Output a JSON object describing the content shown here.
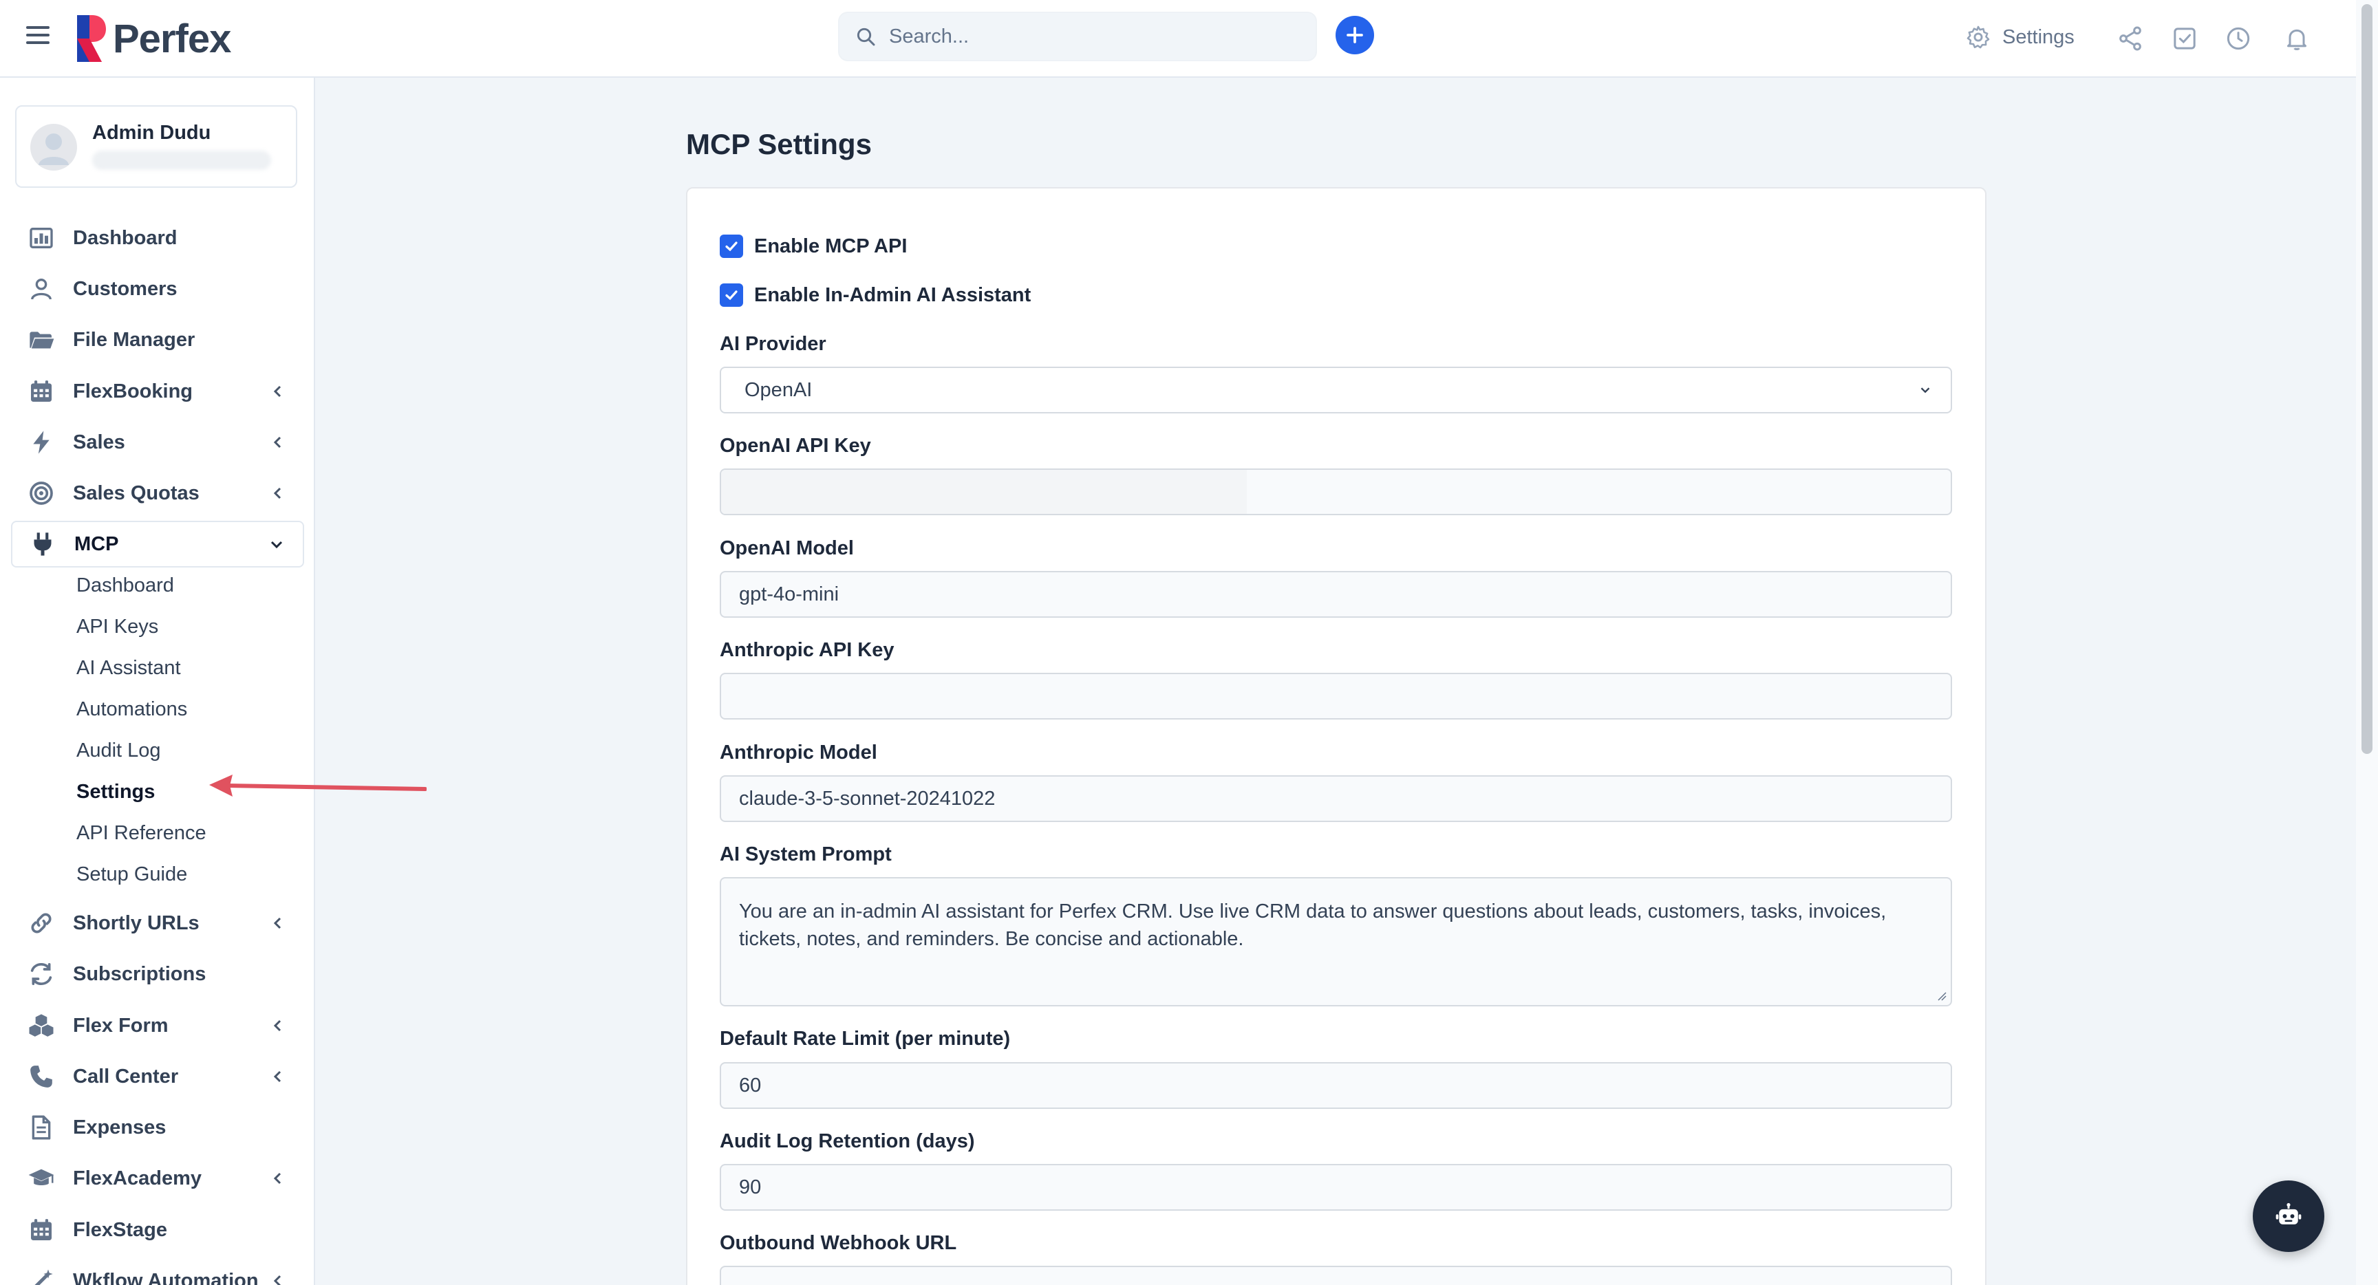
{
  "header": {
    "logo_text": "Perfex",
    "search_placeholder": "Search...",
    "settings_label": "Settings"
  },
  "user": {
    "name": "Admin Dudu"
  },
  "sidebar": {
    "items": [
      {
        "label": "Dashboard",
        "icon": "dashboard-icon"
      },
      {
        "label": "Customers",
        "icon": "user-icon"
      },
      {
        "label": "File Manager",
        "icon": "folder-icon"
      },
      {
        "label": "FlexBooking",
        "icon": "calendar-icon",
        "has_children": true
      },
      {
        "label": "Sales",
        "icon": "bolt-icon",
        "has_children": true
      },
      {
        "label": "Sales Quotas",
        "icon": "target-icon",
        "has_children": true
      },
      {
        "label": "MCP",
        "icon": "plug-icon",
        "expanded": true
      },
      {
        "label": "Shortly URLs",
        "icon": "link-icon",
        "has_children": true
      },
      {
        "label": "Subscriptions",
        "icon": "refresh-icon"
      },
      {
        "label": "Flex Form",
        "icon": "cubes-icon",
        "has_children": true
      },
      {
        "label": "Call Center",
        "icon": "phone-icon",
        "has_children": true
      },
      {
        "label": "Expenses",
        "icon": "file-icon"
      },
      {
        "label": "FlexAcademy",
        "icon": "graduation-cap-icon",
        "has_children": true
      },
      {
        "label": "FlexStage",
        "icon": "calendar-icon"
      },
      {
        "label": "Wkflow Automation",
        "icon": "wand-icon",
        "has_children": true
      }
    ],
    "mcp_sub_items": [
      {
        "label": "Dashboard"
      },
      {
        "label": "API Keys"
      },
      {
        "label": "AI Assistant"
      },
      {
        "label": "Automations"
      },
      {
        "label": "Audit Log"
      },
      {
        "label": "Settings",
        "current": true
      },
      {
        "label": "API Reference"
      },
      {
        "label": "Setup Guide"
      }
    ]
  },
  "main": {
    "title": "MCP Settings",
    "checkboxes": [
      {
        "label": "Enable MCP API",
        "checked": true
      },
      {
        "label": "Enable In-Admin AI Assistant",
        "checked": true
      }
    ],
    "ai_provider": {
      "label": "AI Provider",
      "value": "OpenAI"
    },
    "openai_api_key": {
      "label": "OpenAI API Key",
      "value": ""
    },
    "openai_model": {
      "label": "OpenAI Model",
      "value": "gpt-4o-mini"
    },
    "anthropic_api_key": {
      "label": "Anthropic API Key",
      "value": ""
    },
    "anthropic_model": {
      "label": "Anthropic Model",
      "value": "claude-3-5-sonnet-20241022"
    },
    "system_prompt": {
      "label": "AI System Prompt",
      "value": "You are an in-admin AI assistant for Perfex CRM. Use live CRM data to answer questions about leads, customers, tasks, invoices, tickets, notes, and reminders. Be concise and actionable."
    },
    "rate_limit": {
      "label": "Default Rate Limit (per minute)",
      "value": "60"
    },
    "audit_retention": {
      "label": "Audit Log Retention (days)",
      "value": "90"
    },
    "webhook_url": {
      "label": "Outbound Webhook URL",
      "value": ""
    }
  },
  "colors": {
    "accent": "#2563eb",
    "annotation_arrow": "#e0525f",
    "bot_button": "#1e293b"
  }
}
